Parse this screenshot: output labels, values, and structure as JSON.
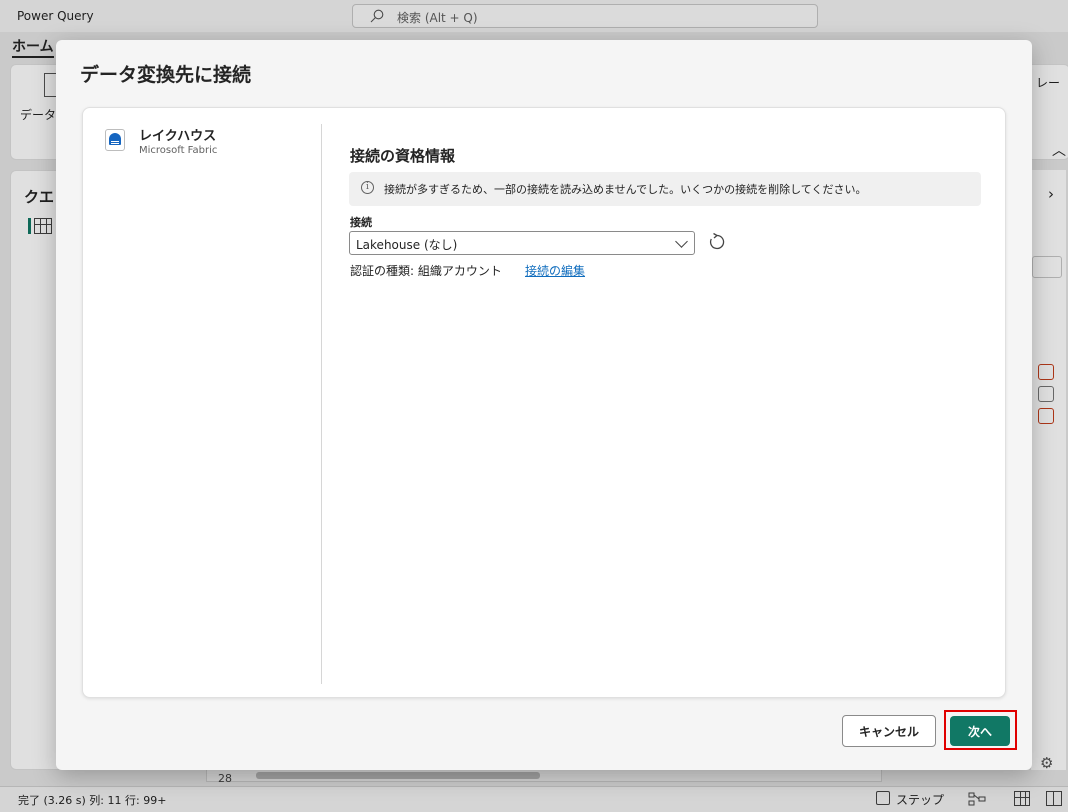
{
  "app": {
    "title": "Power Query",
    "search_placeholder": "検索 (Alt + Q)",
    "home_tab": "ホーム",
    "ribbon_button": "データ",
    "ribbon_right_text": "レー",
    "query_pane_title": "クエ",
    "row_number": "28",
    "status": {
      "text": "完了 (3.26 s)   列: 11   行: 99+",
      "steps_label": "ステップ"
    }
  },
  "dialog": {
    "title": "データ変換先に接続",
    "connector": {
      "name": "レイクハウス",
      "subtitle": "Microsoft Fabric",
      "icon": "lakehouse-icon"
    },
    "credentials": {
      "title": "接続の資格情報",
      "info_message": "接続が多すぎるため、一部の接続を読み込めませんでした。いくつかの接続を削除してください。",
      "connection_label": "接続",
      "connection_value": "Lakehouse (なし)",
      "auth_text": "認証の種類: 組織アカウント",
      "edit_link": "接続の編集"
    },
    "buttons": {
      "cancel": "キャンセル",
      "next": "次へ"
    }
  },
  "colors": {
    "primary": "#117865",
    "link": "#0f6cbd",
    "highlight": "#e00000",
    "lakehouse": "#1565c0"
  }
}
